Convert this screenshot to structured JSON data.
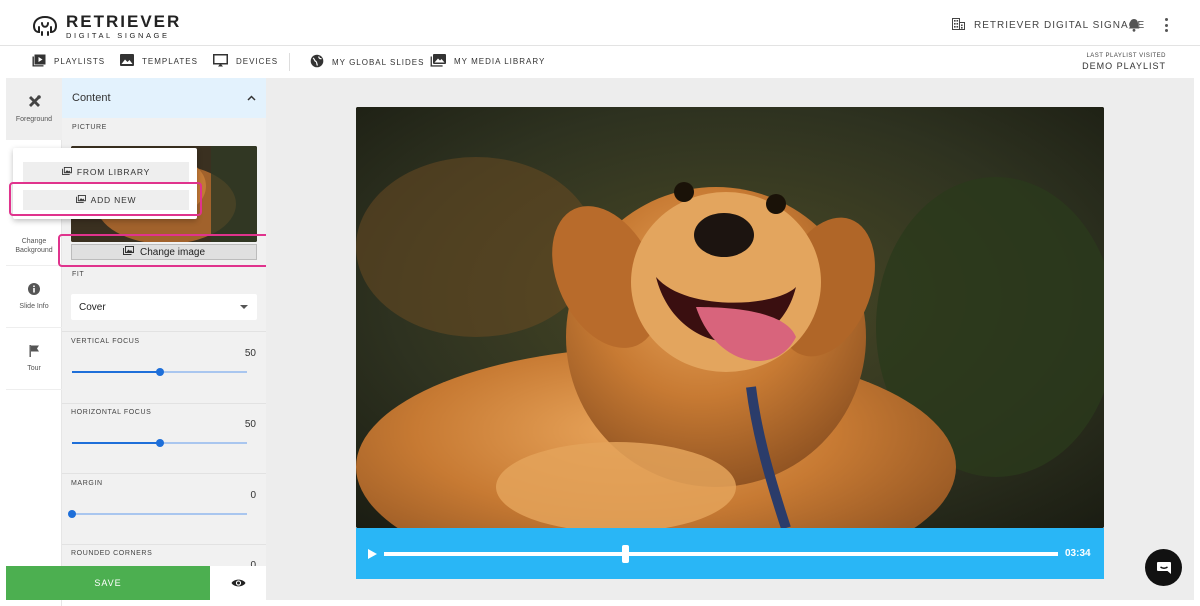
{
  "brand": {
    "title": "RETRIEVER",
    "subtitle": "DIGITAL SIGNAGE"
  },
  "header": {
    "organization": "RETRIEVER DIGITAL SIGNAGE"
  },
  "nav": {
    "items": [
      {
        "label": "PLAYLISTS",
        "icon": "playlist-icon"
      },
      {
        "label": "TEMPLATES",
        "icon": "image-icon"
      },
      {
        "label": "DEVICES",
        "icon": "monitor-icon"
      },
      {
        "label": "MY GLOBAL SLIDES",
        "icon": "globe-icon"
      },
      {
        "label": "MY MEDIA LIBRARY",
        "icon": "media-library-icon"
      }
    ],
    "last_playlist_caption": "LAST PLAYLIST VISITED",
    "last_playlist_value": "DEMO PLAYLIST"
  },
  "rail": {
    "items": [
      {
        "label": "Foreground",
        "icon": "tools-icon",
        "active": true
      },
      {
        "label": "Change Background",
        "icon": "background-icon",
        "active": false
      },
      {
        "label": "Slide Info",
        "icon": "info-icon",
        "active": false
      },
      {
        "label": "Tour",
        "icon": "flag-icon",
        "active": false
      }
    ]
  },
  "panel": {
    "section_title": "Content",
    "picture_label": "PICTURE",
    "change_image_label": "Change image",
    "popup": {
      "from_library": "FROM LIBRARY",
      "add_new": "ADD NEW"
    },
    "fit": {
      "label": "FIT",
      "value": "Cover"
    },
    "vertical_focus": {
      "label": "VERTICAL FOCUS",
      "value": "50",
      "fraction": 0.5
    },
    "horizontal_focus": {
      "label": "HORIZONTAL FOCUS",
      "value": "50",
      "fraction": 0.5
    },
    "margin": {
      "label": "MARGIN",
      "value": "0",
      "fraction": 0
    },
    "rounded_corners": {
      "label": "ROUNDED CORNERS",
      "value": "0"
    }
  },
  "footer": {
    "save_label": "SAVE"
  },
  "player": {
    "time": "03:34",
    "progress": 0.36
  },
  "colors": {
    "accent_blue": "#29b6f6",
    "slider_blue": "#1e6fd9",
    "save_green": "#4caf50",
    "highlight_pink": "#e0338d",
    "panel_header": "#e3f2fd"
  }
}
